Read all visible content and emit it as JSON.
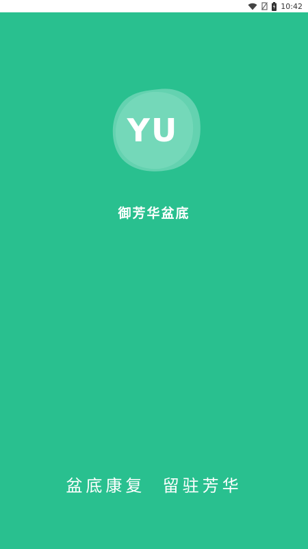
{
  "status_bar": {
    "time": "10:42",
    "icons": [
      "wifi-icon",
      "no-sim-icon",
      "battery-icon"
    ]
  },
  "splash": {
    "logo_text": "YU",
    "app_name": "御芳华盆底",
    "slogan": "盆底康复  留驻芳华"
  },
  "colors": {
    "background": "#29c08f",
    "logo_blob": "#6fd5b6",
    "text": "#ffffff"
  }
}
